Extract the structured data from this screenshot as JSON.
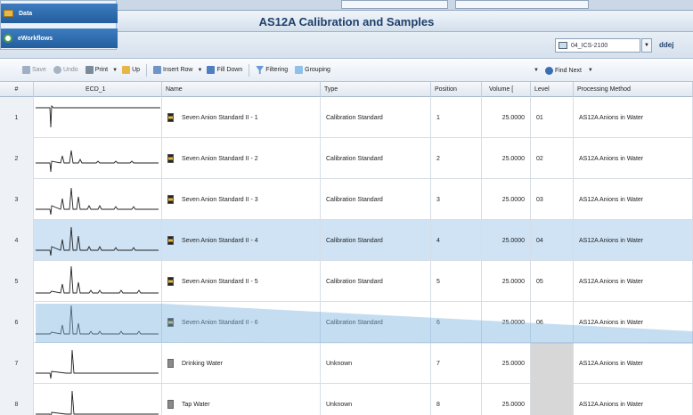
{
  "nav": {
    "items": [
      {
        "label": "Data",
        "icon": "folder-icon"
      },
      {
        "label": "eWorkflows",
        "icon": "workflow-icon"
      }
    ]
  },
  "window": {
    "title": "AS12A Calibration and Samples"
  },
  "header": {
    "instrument": "04_ICS-2100",
    "user": "ddej"
  },
  "toolbar": {
    "save": "Save",
    "undo": "Undo",
    "print": "Print",
    "up": "Up",
    "insert_row": "Insert Row",
    "fill_down": "Fill Down",
    "filtering": "Filtering",
    "grouping": "Grouping",
    "find_next": "Find Next"
  },
  "table": {
    "columns": [
      "#",
      "ECD_1",
      "Name",
      "Type",
      "Position",
      "Volume [",
      "Level",
      "Processing Method"
    ],
    "rows": [
      {
        "num": "1",
        "name": "Seven Anion Standard II - 1",
        "type": "Calibration Standard",
        "position": "1",
        "volume": "25.0000",
        "level": "01",
        "method": "AS12A Anions in Water",
        "icon": "standard"
      },
      {
        "num": "2",
        "name": "Seven Anion Standard II - 2",
        "type": "Calibration Standard",
        "position": "2",
        "volume": "25.0000",
        "level": "02",
        "method": "AS12A Anions in Water",
        "icon": "standard"
      },
      {
        "num": "3",
        "name": "Seven Anion Standard II - 3",
        "type": "Calibration Standard",
        "position": "3",
        "volume": "25.0000",
        "level": "03",
        "method": "AS12A Anions in Water",
        "icon": "standard"
      },
      {
        "num": "4",
        "name": "Seven Anion Standard II - 4",
        "type": "Calibration Standard",
        "position": "4",
        "volume": "25.0000",
        "level": "04",
        "method": "AS12A Anions in Water",
        "icon": "standard"
      },
      {
        "num": "5",
        "name": "Seven Anion Standard II - 5",
        "type": "Calibration Standard",
        "position": "5",
        "volume": "25.0000",
        "level": "05",
        "method": "AS12A Anions in Water",
        "icon": "standard"
      },
      {
        "num": "6",
        "name": "Seven Anion Standard II - 6",
        "type": "Calibration Standard",
        "position": "6",
        "volume": "25.0000",
        "level": "06",
        "method": "AS12A Anions in Water",
        "icon": "standard"
      },
      {
        "num": "7",
        "name": "Drinking Water",
        "type": "Unknown",
        "position": "7",
        "volume": "25.0000",
        "level": "",
        "method": "AS12A Anions in Water",
        "icon": "unknown"
      },
      {
        "num": "8",
        "name": "Tap Water",
        "type": "Unknown",
        "position": "8",
        "volume": "25.0000",
        "level": "",
        "method": "AS12A Anions in Water",
        "icon": "unknown"
      }
    ]
  },
  "selected_row": "4",
  "colors": {
    "selected_row": "#cfe3f5",
    "accent": "#1e3f6b",
    "band": "#7fb4e0"
  }
}
